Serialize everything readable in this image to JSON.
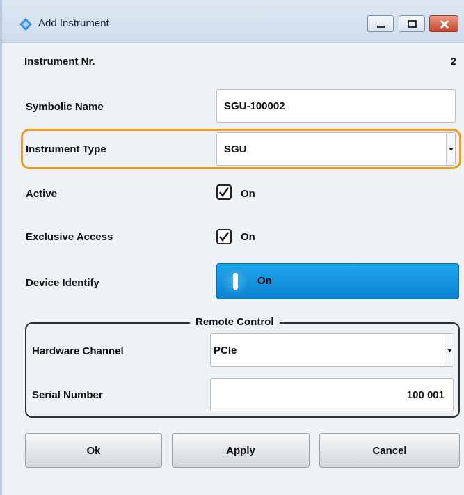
{
  "window": {
    "title": "Add Instrument"
  },
  "fields": {
    "instrument_nr": {
      "label": "Instrument Nr.",
      "value": "2"
    },
    "symbolic_name": {
      "label": "Symbolic Name",
      "value": "SGU-100002"
    },
    "instrument_type": {
      "label": "Instrument Type",
      "value": "SGU"
    },
    "active": {
      "label": "Active",
      "checked": true,
      "state_label": "On"
    },
    "exclusive_access": {
      "label": "Exclusive Access",
      "checked": true,
      "state_label": "On"
    },
    "device_identify": {
      "label": "Device Identify",
      "state_label": "On"
    }
  },
  "remote_control": {
    "title": "Remote Control",
    "hardware_channel": {
      "label": "Hardware Channel",
      "value": "PCIe"
    },
    "serial_number": {
      "label": "Serial Number",
      "value": "100 001"
    }
  },
  "buttons": {
    "ok": "Ok",
    "apply": "Apply",
    "cancel": "Cancel"
  },
  "colors": {
    "highlight": "#f19b1f",
    "toggle_on": "#0b82d0",
    "close_button": "#c8432a"
  },
  "icons": {
    "title": "instrument-diamond-icon",
    "minimize": "minimize-icon",
    "maximize": "maximize-icon",
    "close": "close-icon",
    "dropdown": "chevron-down-icon",
    "checkmark": "checkmark-icon"
  }
}
